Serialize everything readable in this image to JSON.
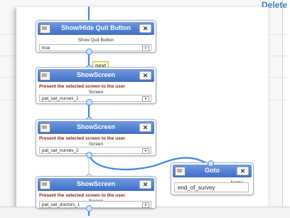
{
  "background": {
    "delete_label": "Delete"
  },
  "nodes": {
    "quit": {
      "title": "Show/Hide Quit Button",
      "field_label": "Show Quit Button",
      "value": "true"
    },
    "screen1": {
      "title": "ShowScreen",
      "description": "Present the selected screen to the user",
      "field_label": "Screen",
      "value": "pat_sat_nurses_1"
    },
    "screen2": {
      "title": "ShowScreen",
      "description": "Present the selected screen to the user",
      "field_label": "Screen",
      "value": "pat_sat_nurses_2"
    },
    "screen3": {
      "title": "ShowScreen",
      "description": "Present the selected screen to the user",
      "field_label": "Screen",
      "value": "pat_sat_doctors_1"
    },
    "goto": {
      "title": "Goto",
      "field_label": "Name",
      "value": "end_of_survey"
    }
  },
  "tooltip": {
    "label": "next"
  },
  "icons": {
    "close": "close-icon",
    "node": "block-icon",
    "dropdown": "chevron-down-icon"
  },
  "colors": {
    "header": "#4f7fd0",
    "description": "#8b1a1a",
    "connector": "#3f86e6",
    "link": "#3d7fc8"
  }
}
